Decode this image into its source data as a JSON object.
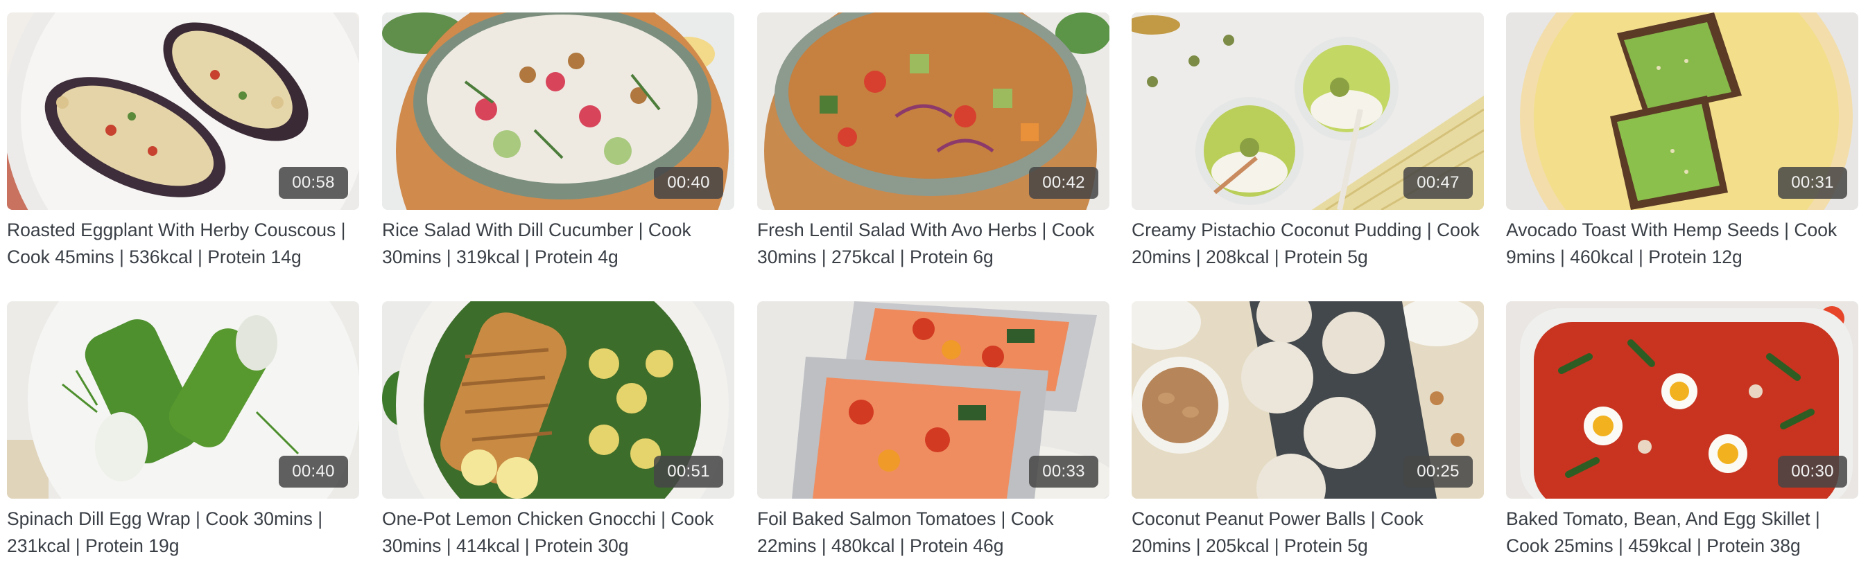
{
  "recipes": [
    {
      "title": "Roasted Eggplant With Herby Couscous | Cook 45mins | 536kcal | Protein 14g",
      "duration": "00:58"
    },
    {
      "title": "Rice Salad With Dill Cucumber | Cook 30mins | 319kcal | Protein 4g",
      "duration": "00:40"
    },
    {
      "title": "Fresh Lentil Salad With Avo Herbs | Cook 30mins | 275kcal | Protein 6g",
      "duration": "00:42"
    },
    {
      "title": "Creamy Pistachio Coconut Pudding | Cook 20mins | 208kcal | Protein 5g",
      "duration": "00:47"
    },
    {
      "title": "Avocado Toast With Hemp Seeds | Cook 9mins | 460kcal | Protein 12g",
      "duration": "00:31"
    },
    {
      "title": "Spinach Dill Egg Wrap | Cook 30mins | 231kcal | Protein 19g",
      "duration": "00:40"
    },
    {
      "title": "One-Pot Lemon Chicken Gnocchi | Cook 30mins | 414kcal | Protein 30g",
      "duration": "00:51"
    },
    {
      "title": "Foil Baked Salmon Tomatoes | Cook 22mins | 480kcal | Protein 46g",
      "duration": "00:33"
    },
    {
      "title": "Coconut Peanut Power Balls | Cook 20mins | 205kcal | Protein 5g",
      "duration": "00:25"
    },
    {
      "title": "Baked Tomato, Bean, And Egg Skillet | Cook 25mins | 459kcal | Protein 38g",
      "duration": "00:30"
    }
  ]
}
